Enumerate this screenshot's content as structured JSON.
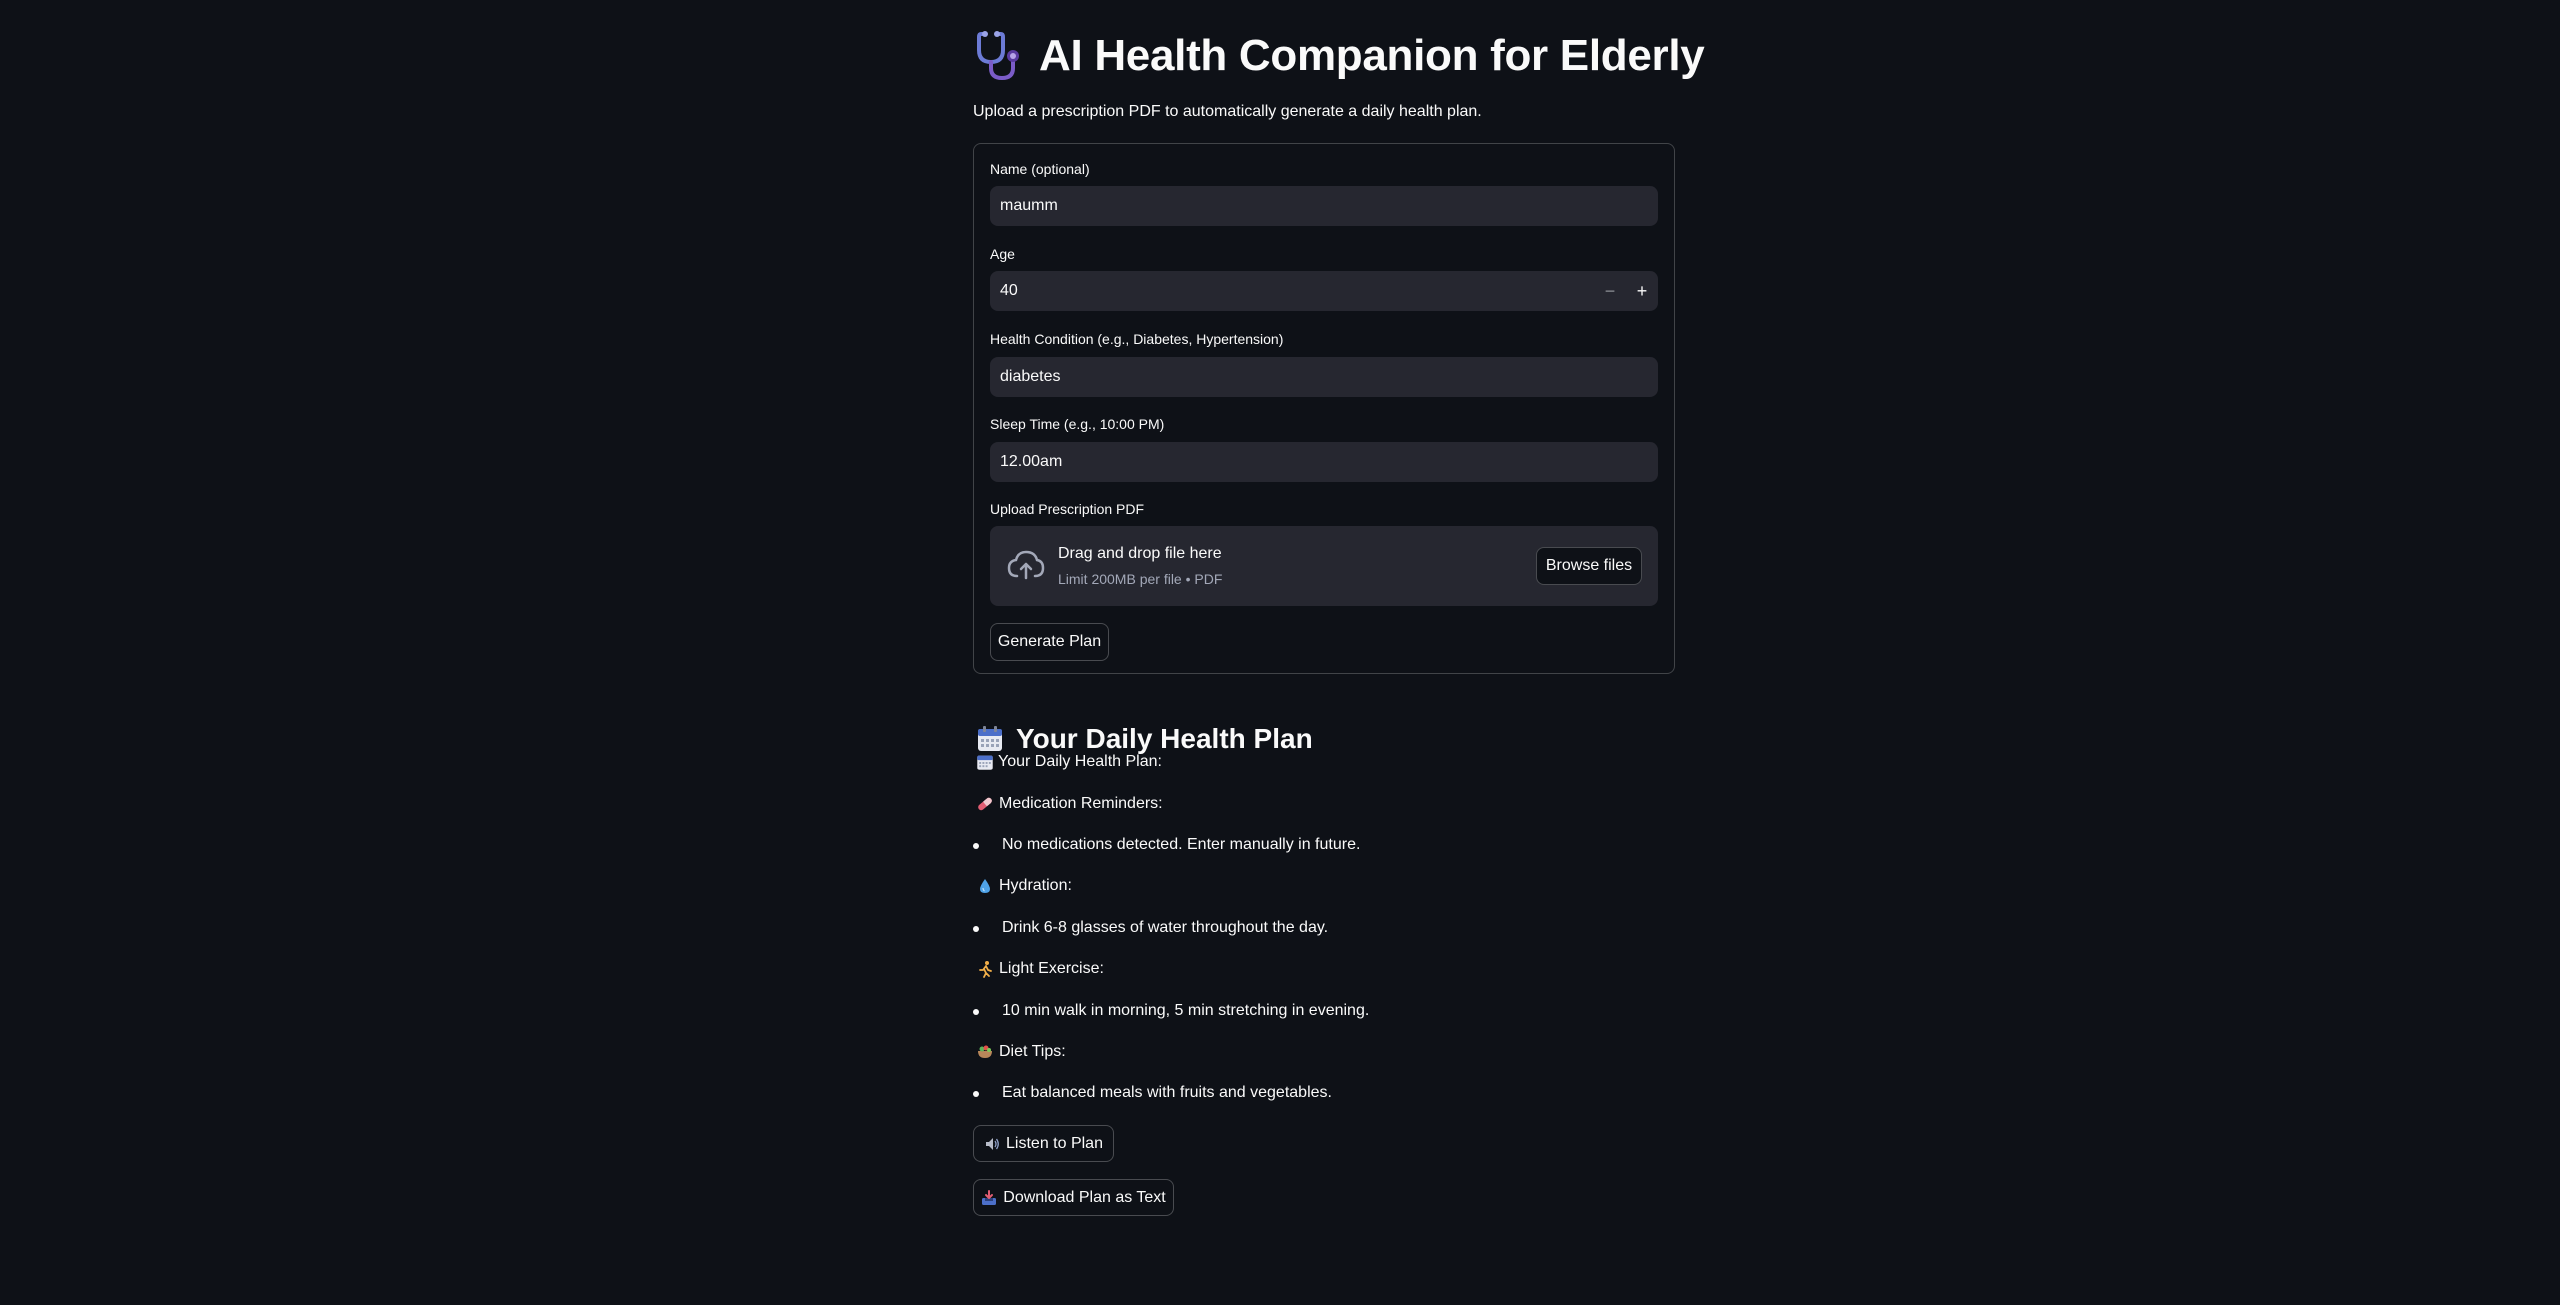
{
  "header": {
    "title": "AI Health Companion for Elderly",
    "title_icon": "stethoscope-icon",
    "subtitle": "Upload a prescription PDF to automatically generate a daily health plan."
  },
  "form": {
    "name": {
      "label": "Name (optional)",
      "value": "maumm"
    },
    "age": {
      "label": "Age",
      "value": "40",
      "minus": "−",
      "plus": "+"
    },
    "condition": {
      "label": "Health Condition (e.g., Diabetes, Hypertension)",
      "value": "diabetes"
    },
    "sleep": {
      "label": "Sleep Time (e.g., 10:00 PM)",
      "value": "12.00am"
    },
    "upload": {
      "label": "Upload Prescription PDF",
      "icon": "cloud-upload-icon",
      "title": "Drag and drop file here",
      "subtitle": "Limit 200MB per file • PDF",
      "browse_label": "Browse files"
    },
    "generate_label": "Generate Plan"
  },
  "plan": {
    "heading": "Your Daily Health Plan",
    "heading_icon": "calendar-icon",
    "intro": "Your Daily Health Plan:",
    "sections": [
      {
        "icon": "pill-icon",
        "title": "Medication Reminders:",
        "item": "No medications detected. Enter manually in future."
      },
      {
        "icon": "droplet-icon",
        "title": "Hydration:",
        "item": "Drink 6-8 glasses of water throughout the day."
      },
      {
        "icon": "running-icon",
        "title": "Light Exercise:",
        "item": "10 min walk in morning, 5 min stretching in evening."
      },
      {
        "icon": "salad-icon",
        "title": "Diet Tips:",
        "item": "Eat balanced meals with fruits and vegetables."
      }
    ],
    "listen_label": "Listen to Plan",
    "listen_icon": "speaker-icon",
    "download_label": "Download Plan as Text",
    "download_icon": "inbox-tray-icon"
  },
  "colors": {
    "background": "#0e1117",
    "input_bg": "#262730",
    "text": "#fafafa",
    "muted": "#a3a8b8"
  }
}
